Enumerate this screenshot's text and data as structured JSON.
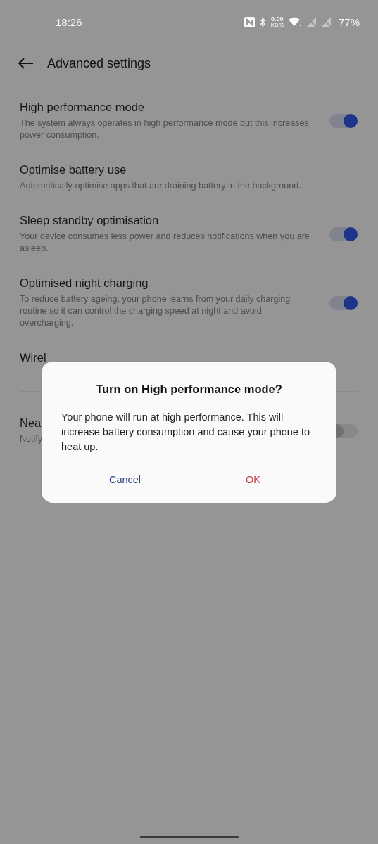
{
  "status_bar": {
    "time": "18:26",
    "data_speed": "0.00",
    "data_unit": "KB/S",
    "battery": "77%"
  },
  "header": {
    "title": "Advanced settings"
  },
  "settings": [
    {
      "title": "High performance mode",
      "description": "The system always operates in high performance mode but this increases power consumption.",
      "on": true
    },
    {
      "title": "Optimise battery use",
      "description": "Automatically optimise apps that are draining battery in the background."
    },
    {
      "title": "Sleep standby optimisation",
      "description": "Your device consumes less power and reduces notifications when you are asleep.",
      "on": true
    },
    {
      "title": "Optimised night charging",
      "description": "To reduce battery ageing, your phone learns from your daily charging routine so it can control the charging speed at night and avoid overcharging.",
      "on": true
    },
    {
      "title": "Wirel",
      "divider": true
    },
    {
      "title": "Nea",
      "description": "Notify",
      "on": false
    }
  ],
  "dialog": {
    "title": "Turn on High performance mode?",
    "message": "Your phone will run at high performance. This will increase battery consumption and cause your phone to heat up.",
    "buttons": [
      {
        "label": "Cancel",
        "kind": "cancel"
      },
      {
        "label": "OK",
        "kind": "confirm"
      }
    ]
  }
}
